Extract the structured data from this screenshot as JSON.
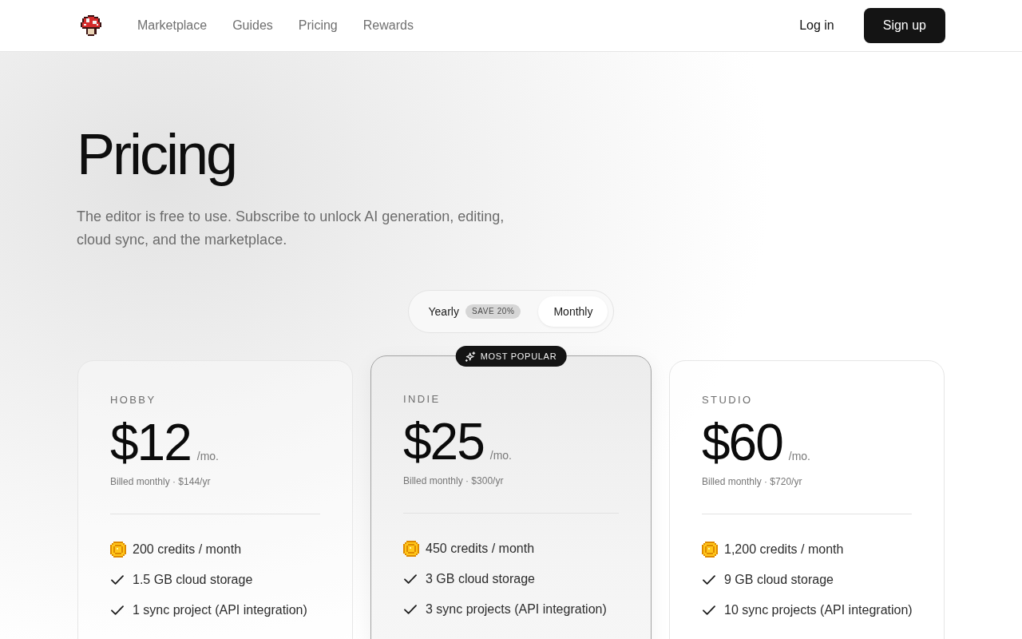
{
  "header": {
    "nav": [
      {
        "label": "Marketplace"
      },
      {
        "label": "Guides"
      },
      {
        "label": "Pricing"
      },
      {
        "label": "Rewards"
      }
    ],
    "login": "Log in",
    "signup": "Sign up"
  },
  "hero": {
    "title": "Pricing",
    "subtitle": "The editor is free to use. Subscribe to unlock AI generation, editing, cloud sync, and the marketplace."
  },
  "billing_toggle": {
    "options": [
      {
        "label": "Yearly",
        "badge": "SAVE 20%",
        "selected": false
      },
      {
        "label": "Monthly",
        "selected": true
      }
    ]
  },
  "plans": [
    {
      "name": "HOBBY",
      "price": "$12",
      "period": "/mo.",
      "billing": "Billed monthly · $144/yr",
      "featured": false,
      "features": [
        {
          "kind": "credits",
          "text": "200 credits / month"
        },
        {
          "kind": "check",
          "text": "1.5 GB cloud storage"
        },
        {
          "kind": "check",
          "text": "1 sync project (API integration)"
        }
      ]
    },
    {
      "name": "INDIE",
      "price": "$25",
      "period": "/mo.",
      "billing": "Billed monthly · $300/yr",
      "featured": true,
      "badge": "MOST POPULAR",
      "features": [
        {
          "kind": "credits",
          "text": "450 credits / month"
        },
        {
          "kind": "check",
          "text": "3 GB cloud storage"
        },
        {
          "kind": "check",
          "text": "3 sync projects (API integration)"
        }
      ]
    },
    {
      "name": "STUDIO",
      "price": "$60",
      "period": "/mo.",
      "billing": "Billed monthly · $720/yr",
      "featured": false,
      "features": [
        {
          "kind": "credits",
          "text": "1,200 credits / month"
        },
        {
          "kind": "check",
          "text": "9 GB cloud storage"
        },
        {
          "kind": "check",
          "text": "10 sync projects (API integration)"
        }
      ]
    }
  ]
}
